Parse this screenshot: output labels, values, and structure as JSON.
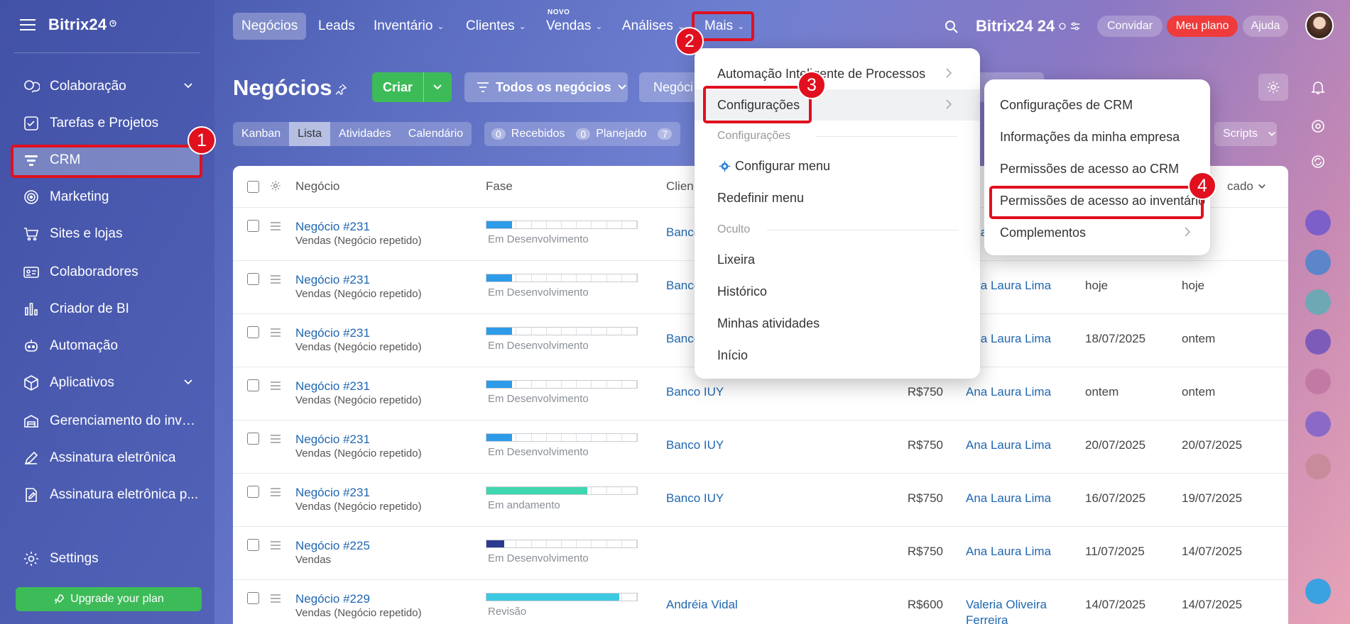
{
  "colors": {
    "accent_green": "#3dbb58",
    "link_blue": "#2067b0",
    "highlight_red": "#e0101f",
    "plan_red": "#ef3b3b",
    "phase_blue": "#2e9be8",
    "phase_green": "#3fd6b0",
    "phase_navy": "#2a3b8f",
    "phase_cyan": "#3cc9e2"
  },
  "sidebar": {
    "brand": "Bitrix24",
    "items": [
      {
        "label": "Colaboração",
        "icon": "chat-bubbles-icon"
      },
      {
        "label": "Tarefas e Projetos",
        "icon": "checkbox-icon"
      },
      {
        "label": "CRM",
        "icon": "crm-filter-icon"
      },
      {
        "label": "Marketing",
        "icon": "target-icon"
      },
      {
        "label": "Sites e lojas",
        "icon": "cart-icon"
      },
      {
        "label": "Colaboradores",
        "icon": "id-card-icon"
      },
      {
        "label": "Criador de BI",
        "icon": "bar-chart-icon"
      },
      {
        "label": "Automação",
        "icon": "robot-icon"
      },
      {
        "label": "Aplicativos",
        "icon": "cube-icon"
      },
      {
        "label": "Gerenciamento do inve...",
        "icon": "warehouse-icon"
      },
      {
        "label": "Assinatura eletrônica",
        "icon": "pen-icon"
      },
      {
        "label": "Assinatura eletrônica p...",
        "icon": "document-pen-icon"
      }
    ],
    "settings": "Settings",
    "upgrade": "Upgrade your plan"
  },
  "topnav": {
    "items": [
      {
        "label": "Negócios"
      },
      {
        "label": "Leads"
      },
      {
        "label": "Inventário"
      },
      {
        "label": "Clientes"
      },
      {
        "label": "Vendas"
      },
      {
        "label": "Análises"
      },
      {
        "label": "Mais"
      }
    ],
    "novo": "NOVO",
    "brand": "Bitrix24",
    "brand_num": "24",
    "invite": "Convidar",
    "plan": "Meu plano",
    "help": "Ajuda"
  },
  "toolbar": {
    "title": "Negócios",
    "create": "Criar",
    "filter": "Todos os negócios",
    "search_placeholder": "Negóci",
    "views": [
      "Kanban",
      "Lista",
      "Atividades",
      "Calendário"
    ],
    "counters": [
      {
        "n": "0",
        "label": "Recebidos"
      },
      {
        "n": "0",
        "label": "Planejado"
      },
      {
        "n": "7",
        "label": ""
      }
    ],
    "scripts": "Scripts"
  },
  "table": {
    "headers": {
      "deal": "Negócio",
      "phase": "Fase",
      "client": "Clien",
      "modified": "cado"
    },
    "rows": [
      {
        "name": "Negócio #231",
        "sub": "Vendas (Negócio repetido)",
        "phase": "Em Desenvolvimento",
        "fill": 0.17,
        "color": "#2e9be8",
        "client": "Banco IUY",
        "amount": "",
        "owner": "Ana Laura Lima",
        "owner2": "",
        "created": "",
        "modified": ""
      },
      {
        "name": "Negócio #231",
        "sub": "Vendas (Negócio repetido)",
        "phase": "Em Desenvolvimento",
        "fill": 0.17,
        "color": "#2e9be8",
        "client": "Banco IUY",
        "amount": "",
        "owner": "Ana Laura Lima",
        "owner2": "",
        "created": "hoje",
        "modified": "hoje"
      },
      {
        "name": "Negócio #231",
        "sub": "Vendas (Negócio repetido)",
        "phase": "Em Desenvolvimento",
        "fill": 0.17,
        "color": "#2e9be8",
        "client": "Banco IUY",
        "amount": "",
        "owner": "Ana Laura Lima",
        "owner2": "",
        "created": "18/07/2025",
        "modified": "ontem"
      },
      {
        "name": "Negócio #231",
        "sub": "Vendas (Negócio repetido)",
        "phase": "Em Desenvolvimento",
        "fill": 0.17,
        "color": "#2e9be8",
        "client": "Banco IUY",
        "amount": "R$750",
        "owner": "Ana Laura Lima",
        "owner2": "",
        "created": "ontem",
        "modified": "ontem"
      },
      {
        "name": "Negócio #231",
        "sub": "Vendas (Negócio repetido)",
        "phase": "Em Desenvolvimento",
        "fill": 0.17,
        "color": "#2e9be8",
        "client": "Banco IUY",
        "amount": "R$750",
        "owner": "Ana Laura Lima",
        "owner2": "",
        "created": "20/07/2025",
        "modified": "20/07/2025"
      },
      {
        "name": "Negócio #231",
        "sub": "Vendas (Negócio repetido)",
        "phase": "Em andamento",
        "fill": 0.67,
        "color": "#3fd6b0",
        "client": "Banco IUY",
        "amount": "R$750",
        "owner": "Ana Laura Lima",
        "owner2": "",
        "created": "16/07/2025",
        "modified": "19/07/2025"
      },
      {
        "name": "Negócio #225",
        "sub": "Vendas",
        "phase": "Em Desenvolvimento",
        "fill": 0.12,
        "color": "#2a3b8f",
        "client": "",
        "amount": "R$750",
        "owner": "Ana Laura Lima",
        "owner2": "",
        "created": "11/07/2025",
        "modified": "14/07/2025"
      },
      {
        "name": "Negócio #229",
        "sub": "Vendas (Negócio repetido)",
        "phase": "Revisão",
        "fill": 0.88,
        "color": "#3cc9e2",
        "client": "Andréia Vidal",
        "amount": "R$600",
        "owner": "Valeria Oliveira",
        "owner2": "Ferreira",
        "created": "14/07/2025",
        "modified": "14/07/2025"
      }
    ]
  },
  "menu_mais": {
    "items": [
      "Automação Inteligente de Processos",
      "Configurações"
    ],
    "section_config": "Configurações",
    "config_items": [
      "Configurar menu",
      "Redefinir menu"
    ],
    "section_hidden": "Oculto",
    "hidden_items": [
      "Lixeira",
      "Histórico",
      "Minhas atividades",
      "Início"
    ]
  },
  "menu_config": {
    "items": [
      "Configurações de CRM",
      "Informações da minha empresa",
      "Permissões de acesso ao CRM",
      "Permissões de acesso ao inventário",
      "Complementos"
    ]
  },
  "badges": [
    "1",
    "2",
    "3",
    "4"
  ]
}
